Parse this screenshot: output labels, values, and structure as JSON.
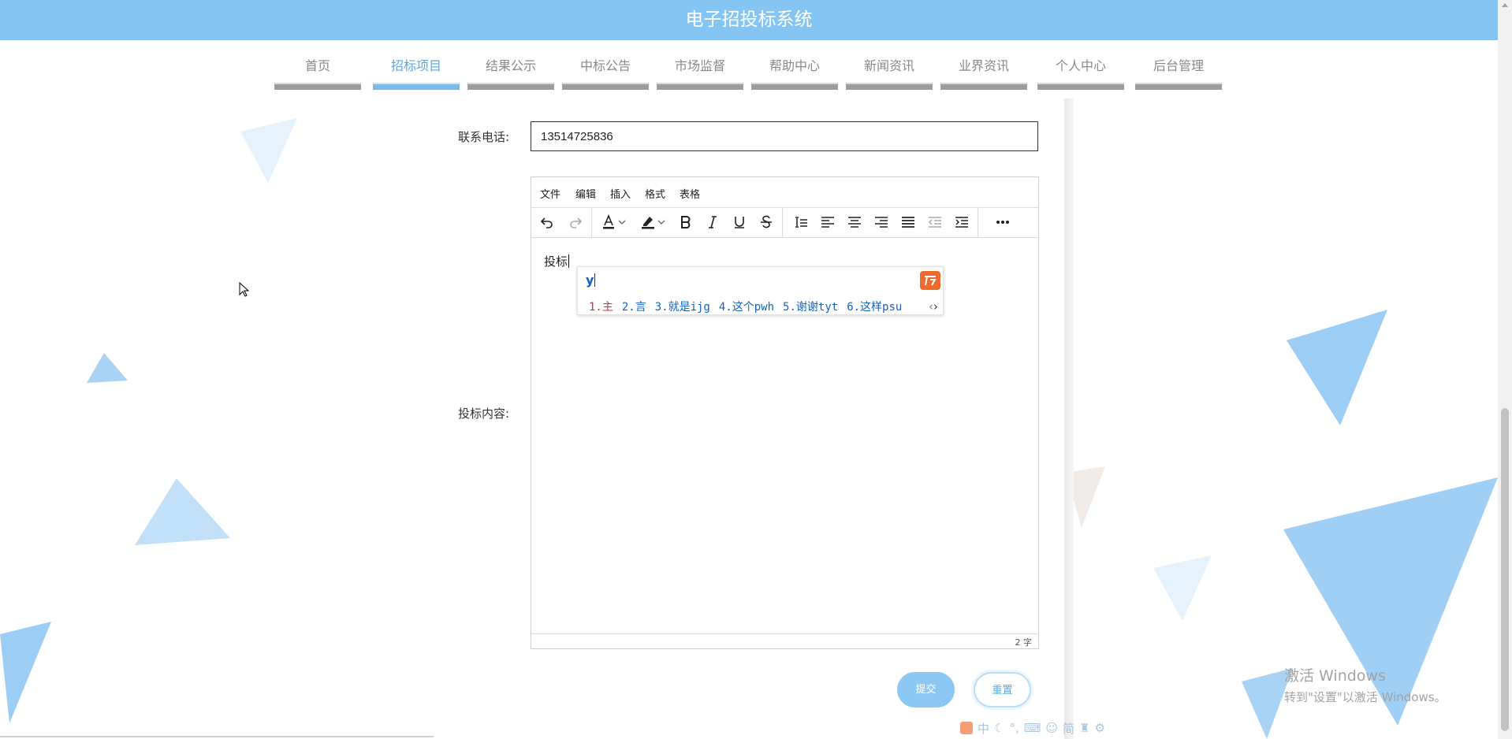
{
  "header": {
    "title": "电子招投标系统"
  },
  "nav": {
    "items": [
      {
        "label": "首页"
      },
      {
        "label": "招标项目",
        "active": true
      },
      {
        "label": "结果公示"
      },
      {
        "label": "中标公告"
      },
      {
        "label": "市场监督"
      },
      {
        "label": "帮助中心"
      },
      {
        "label": "新闻资讯"
      },
      {
        "label": "业界资讯"
      },
      {
        "label": "个人中心"
      },
      {
        "label": "后台管理"
      }
    ]
  },
  "form": {
    "phone": {
      "label": "联系电话:",
      "value": "13514725836"
    },
    "content": {
      "label": "投标内容:"
    }
  },
  "editor": {
    "menu": [
      "文件",
      "编辑",
      "插入",
      "格式",
      "表格"
    ],
    "toolbar": [
      "undo-icon",
      "redo-icon",
      "text-color-icon",
      "highlight-icon",
      "bold-icon",
      "italic-icon",
      "underline-icon",
      "strikethrough-icon",
      "line-height-icon",
      "align-left-icon",
      "align-center-icon",
      "align-right-icon",
      "align-justify-icon",
      "outdent-icon",
      "indent-icon",
      "more-icon"
    ],
    "text": "投标",
    "word_count": "2 字"
  },
  "ime": {
    "pinyin": "y",
    "candidates": [
      "1.主",
      "2.言",
      "3.就是ijg",
      "4.这个pwh",
      "5.谢谢tyt",
      "6.这样psu"
    ]
  },
  "buttons": {
    "submit": "提交",
    "reset": "重置"
  },
  "watermark": {
    "title": "激活 Windows",
    "subtitle": "转到\"设置\"以激活 Windows。"
  },
  "ime_status": {
    "items": [
      "中",
      "简"
    ]
  }
}
